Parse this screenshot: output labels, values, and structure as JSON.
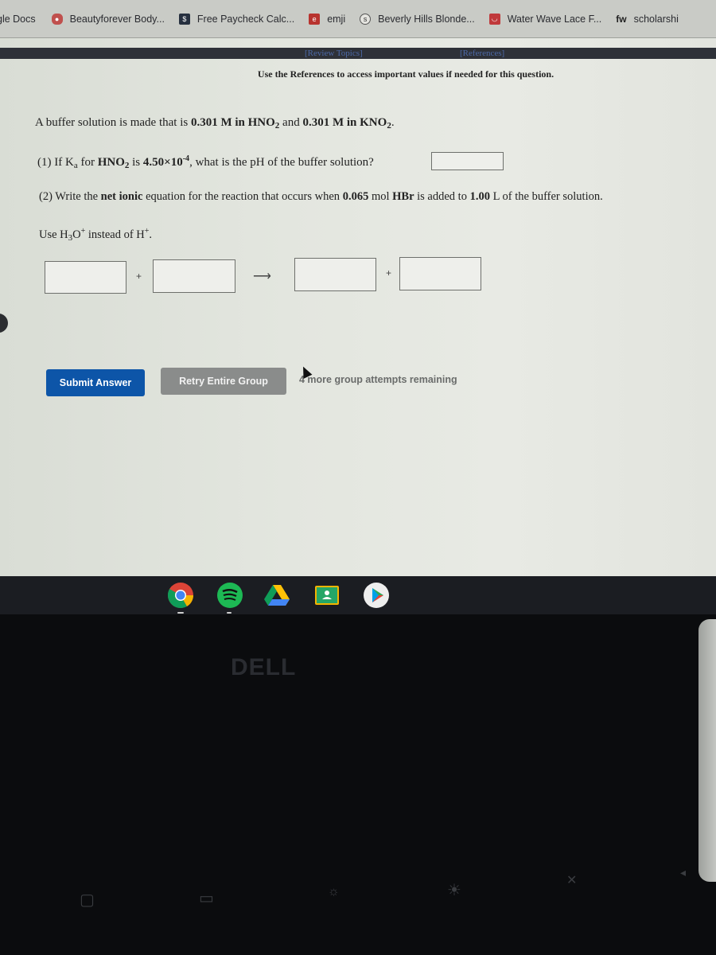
{
  "bookmarks": [
    {
      "label": "gle Docs",
      "icon": "google-docs-icon"
    },
    {
      "label": "Beautyforever Body...",
      "icon": "beautyforever-icon"
    },
    {
      "label": "Free Paycheck Calc...",
      "icon": "paycheck-icon"
    },
    {
      "label": "emji",
      "icon": "emji-icon"
    },
    {
      "label": "Beverly Hills Blonde...",
      "icon": "beverly-hills-icon"
    },
    {
      "label": "Water Wave Lace F...",
      "icon": "aliexpress-icon"
    },
    {
      "label": "scholarshi",
      "icon": "fastweb-icon",
      "icon_text": "fw"
    }
  ],
  "references_bar": {
    "review_topics": "[Review Topics]",
    "references": "[References]"
  },
  "notice": "Use the References to access important values if needed for this question.",
  "question": {
    "intro_prefix": "A buffer solution is made that is ",
    "conc1": "0.301 M in HNO",
    "conc1_sub": "2",
    "intro_mid": " and ",
    "conc2": "0.301 M in KNO",
    "conc2_sub": "2",
    "intro_end": ".",
    "part1_prefix": "(1) If K",
    "part1_sub": "a",
    "part1_for": " for ",
    "part1_acid": "HNO",
    "part1_acid_sub": "2",
    "part1_is": " is ",
    "part1_ka": "4.50×10",
    "part1_ka_exp": "-4",
    "part1_end": ", what is the pH of the buffer solution?",
    "part1_answer": "",
    "part2_prefix": "(2) Write the ",
    "part2_bold": "net ionic",
    "part2_mid": " equation for the reaction that occurs when ",
    "part2_amount": "0.065",
    "part2_unit": " mol ",
    "part2_reagent": "HBr",
    "part2_mid2": " is added to ",
    "part2_volume": "1.00",
    "part2_end": " L of the buffer solution.",
    "hint_prefix": "Use H",
    "hint_sub": "3",
    "hint_o": "O",
    "hint_sup": "+",
    "hint_mid": " instead of H",
    "hint_sup2": "+",
    "hint_end": ".",
    "equation": {
      "reactant1": "",
      "reactant2": "",
      "product1": "",
      "product2": "",
      "plus": "+",
      "arrow": "⟶"
    }
  },
  "actions": {
    "submit": "Submit Answer",
    "retry": "Retry Entire Group",
    "attempts_remaining": "4 more group attempts remaining"
  },
  "shelf_apps": [
    "chrome-icon",
    "spotify-icon",
    "google-drive-icon",
    "google-classroom-icon",
    "play-store-icon"
  ],
  "bezel": {
    "brand": "DELL"
  },
  "colors": {
    "submit_bg": "#0d55a8",
    "retry_bg": "#8a8c8b",
    "ref_link": "#4d6aa8"
  }
}
